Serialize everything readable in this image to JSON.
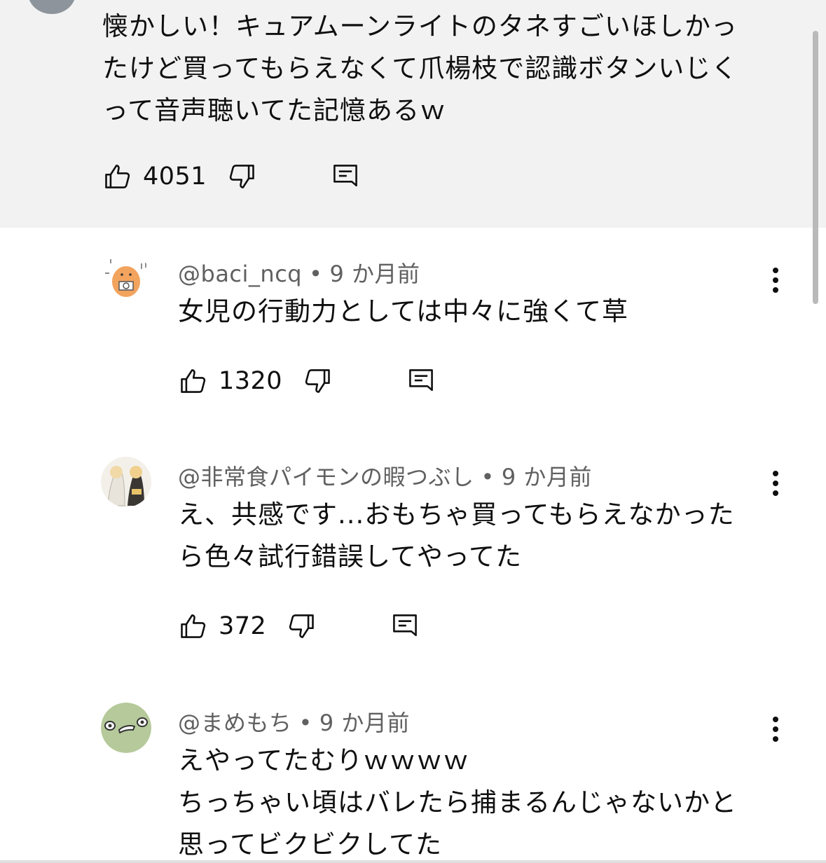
{
  "top_comment": {
    "text_lines": [
      "懐かしい！キュアムーンライトのタネすごいほしかっ",
      "たけど買ってもらえなくて爪楊枝で認識ボタンいじく",
      "って音声聴いてた記憶あるｗ"
    ],
    "like_count": "4051"
  },
  "comments": [
    {
      "author": "@baci_ncq",
      "separator": "•",
      "time": "9 か月前",
      "text_lines": [
        "女児の行動力としては中々に強くて草"
      ],
      "like_count": "1320"
    },
    {
      "author": "@非常食パイモンの暇つぶし",
      "separator": "•",
      "time": "9 か月前",
      "text_lines": [
        "え、共感です...おもちゃ買ってもらえなかった",
        "ら色々試行錯誤してやってた"
      ],
      "like_count": "372"
    },
    {
      "author": "@まめもち",
      "separator": "•",
      "time": "9 か月前",
      "text_lines": [
        "えやってたむりｗｗｗｗ",
        "ちっちゃい頃はバレたら捕まるんじゃないかと",
        "思ってビクビクしてた"
      ]
    }
  ],
  "icons": {
    "like": "thumbs-up-icon",
    "dislike": "thumbs-down-icon",
    "reply": "reply-comment-icon",
    "more": "more-vert-icon"
  },
  "colors": {
    "highlight_background": "#f2f2f2",
    "text_primary": "#0f0f0f",
    "text_secondary": "#606060",
    "avatar_green": "#b5c99a"
  }
}
